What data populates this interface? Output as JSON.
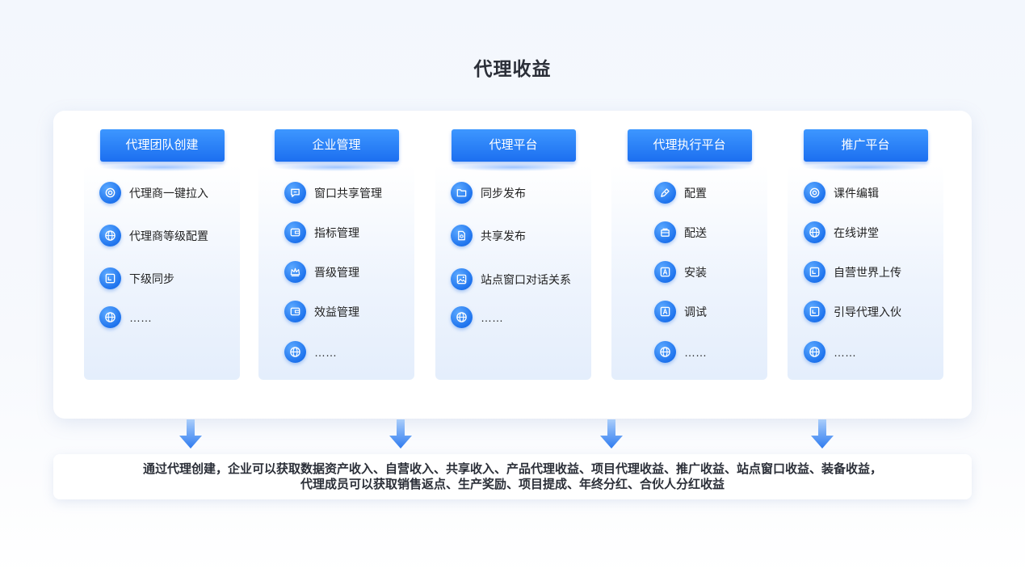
{
  "title": "代理收益",
  "columns": [
    {
      "header": "代理团队创建",
      "items": [
        {
          "label": "代理商一键拉入",
          "icon": "target-icon"
        },
        {
          "label": "代理商等级配置",
          "icon": "globe-icon"
        },
        {
          "label": "下级同步",
          "icon": "screen-icon"
        },
        {
          "label": "……",
          "icon": "globe-icon"
        }
      ]
    },
    {
      "header": "企业管理",
      "items": [
        {
          "label": "窗口共享管理",
          "icon": "chat-icon"
        },
        {
          "label": "指标管理",
          "icon": "wallet-icon"
        },
        {
          "label": "晋级管理",
          "icon": "crown-icon"
        },
        {
          "label": "效益管理",
          "icon": "wallet-icon"
        },
        {
          "label": "……",
          "icon": "globe-icon"
        }
      ]
    },
    {
      "header": "代理平台",
      "items": [
        {
          "label": "同步发布",
          "icon": "folder-icon"
        },
        {
          "label": "共享发布",
          "icon": "document-icon"
        },
        {
          "label": "站点窗口对话关系",
          "icon": "image-icon"
        },
        {
          "label": "……",
          "icon": "globe-icon"
        }
      ]
    },
    {
      "header": "代理执行平台",
      "items": [
        {
          "label": "配置",
          "icon": "pen-icon"
        },
        {
          "label": "配送",
          "icon": "box-icon"
        },
        {
          "label": "安装",
          "icon": "install-icon"
        },
        {
          "label": "调试",
          "icon": "install-icon"
        },
        {
          "label": "……",
          "icon": "globe-icon"
        }
      ]
    },
    {
      "header": "推广平台",
      "items": [
        {
          "label": "课件编辑",
          "icon": "target-icon"
        },
        {
          "label": "在线讲堂",
          "icon": "globe-icon"
        },
        {
          "label": "自营世界上传",
          "icon": "screen-icon"
        },
        {
          "label": "引导代理入伙",
          "icon": "screen-icon"
        },
        {
          "label": "……",
          "icon": "globe-icon"
        }
      ]
    }
  ],
  "summary": {
    "line1": "通过代理创建，企业可以获取数据资产收入、自营收入、共享收入、产品代理收益、项目代理收益、推广收益、站点窗口收益、装备收益，",
    "line2": "代理成员可以获取销售返点、生产奖励、项目提成、年终分红、合伙人分红收益"
  },
  "colors": {
    "accent": "#1f74ee",
    "header_top": "#3d97ff",
    "header_bottom": "#1c6ff0",
    "arrow": "#3d86f2"
  }
}
